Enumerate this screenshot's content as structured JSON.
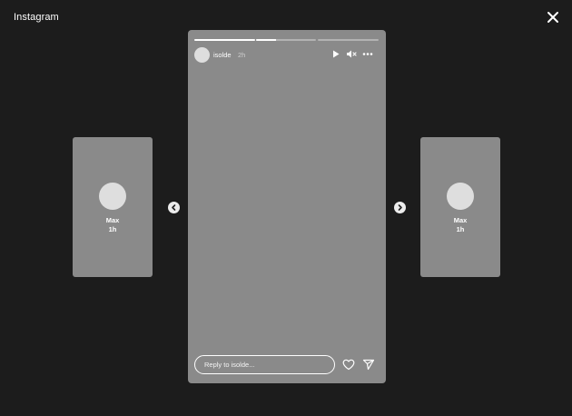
{
  "app": {
    "title": "Instagram"
  },
  "story": {
    "username": "isolde",
    "time": "2h",
    "progress": [
      1.0,
      0.33,
      0.0
    ],
    "reply_placeholder": "Reply to isolde..."
  },
  "prev_story": {
    "name": "Max",
    "time": "1h"
  },
  "next_story": {
    "name": "Max",
    "time": "1h"
  },
  "icons": {
    "close": "close-icon",
    "prev": "chevron-left-icon",
    "next": "chevron-right-icon",
    "play": "play-icon",
    "mute": "volume-mute-icon",
    "more": "more-horizontal-icon",
    "like": "heart-icon",
    "send": "send-icon"
  },
  "colors": {
    "background": "#1c1c1c",
    "card": "#8a8a8a",
    "avatar": "#dedede",
    "text": "#ffffff"
  }
}
